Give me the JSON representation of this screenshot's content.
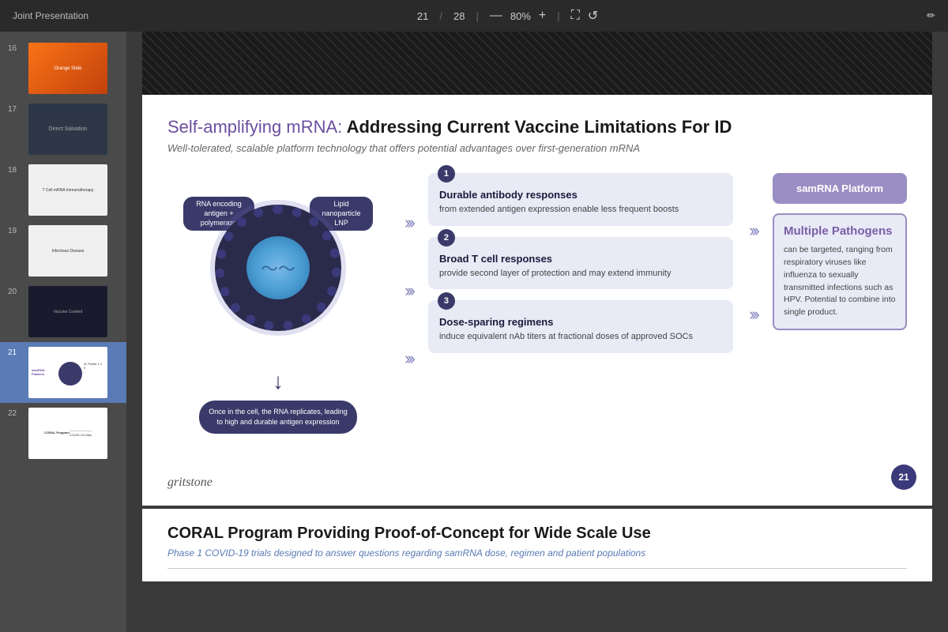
{
  "toolbar": {
    "title": "Joint Presentation",
    "current_page": "21",
    "total_pages": "28",
    "zoom": "80%",
    "edit_icon": "✏"
  },
  "sidebar": {
    "slides": [
      {
        "num": "16",
        "theme": "orange"
      },
      {
        "num": "17",
        "theme": "dark"
      },
      {
        "num": "18",
        "theme": "light"
      },
      {
        "num": "19",
        "theme": "light2"
      },
      {
        "num": "20",
        "theme": "dark2"
      },
      {
        "num": "21",
        "theme": "white",
        "active": true
      },
      {
        "num": "22",
        "theme": "white2"
      }
    ]
  },
  "slide21": {
    "title_purple": "Self-amplifying mRNA:",
    "title_bold": " Addressing Current Vaccine Limitations For ID",
    "subtitle": "Well-tolerated, scalable platform technology that offers potential advantages over first-generation mRNA",
    "diagram": {
      "label_rna": "RNA encoding antigen + polymerase",
      "label_lnp": "Lipid nanoparticle LNP",
      "label_cell": "Once in the cell, the RNA replicates, leading to high and durable antigen expression"
    },
    "points": [
      {
        "num": "1",
        "title": "Durable antibody responses",
        "desc": "from extended antigen expression enable less frequent boosts"
      },
      {
        "num": "2",
        "title": "Broad T cell responses",
        "desc": "provide second layer of protection and may extend immunity"
      },
      {
        "num": "3",
        "title": "Dose-sparing regimens",
        "desc": "induce equivalent nAb titers at fractional doses of approved SOCs"
      }
    ],
    "right_panel": {
      "samrna_label": "samRNA Platform",
      "pathogens_title": "Multiple Pathogens",
      "pathogens_desc": "can be targeted, ranging from respiratory viruses like influenza to sexually transmitted infections such as HPV. Potential to combine into single product."
    },
    "logo": "gritstone",
    "badge": "21"
  },
  "slide22": {
    "title": "CORAL Program Providing Proof-of-Concept for Wide Scale Use",
    "subtitle": "Phase 1 COVID-19 trials designed to answer questions regarding samRNA dose, regimen and patient populations"
  }
}
